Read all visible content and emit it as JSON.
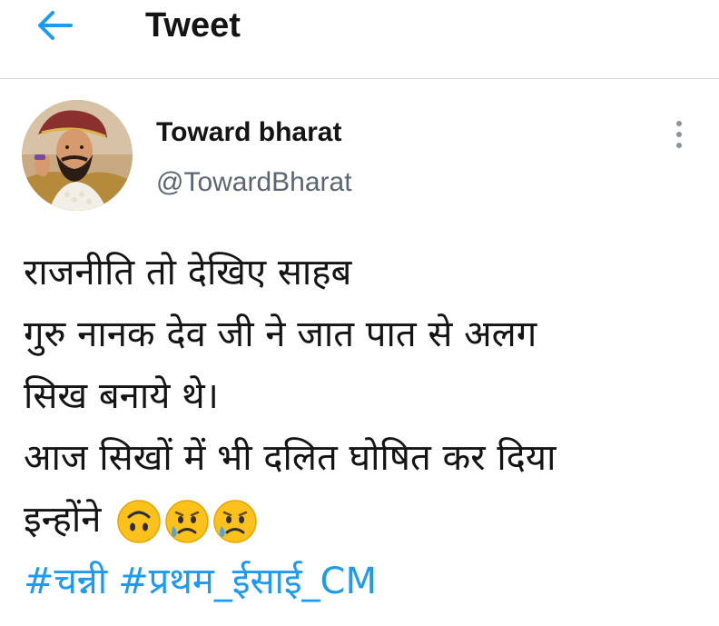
{
  "header": {
    "title": "Tweet",
    "back_icon": "arrow-left-icon",
    "accent_color": "#1d9bf0"
  },
  "tweet": {
    "author": {
      "display_name": "Toward bharat",
      "handle": "@TowardBharat",
      "avatar_icon": "profile-portrait-avatar"
    },
    "more_icon": "vertical-ellipsis-icon",
    "text_lines": [
      "राजनीति तो देखिए साहब",
      "गुरु नानक देव जी ने जात पात से अलग",
      "सिख बनाये थे।",
      "आज सिखों में भी दलित घोषित कर दिया",
      "इन्होंने"
    ],
    "emojis": [
      "upside-down-face-emoji",
      "sad-but-relieved-face-emoji",
      "sad-but-relieved-face-emoji"
    ],
    "hashtags": [
      "#चन्नी",
      "#प्रथम_ईसाई_CM"
    ]
  }
}
